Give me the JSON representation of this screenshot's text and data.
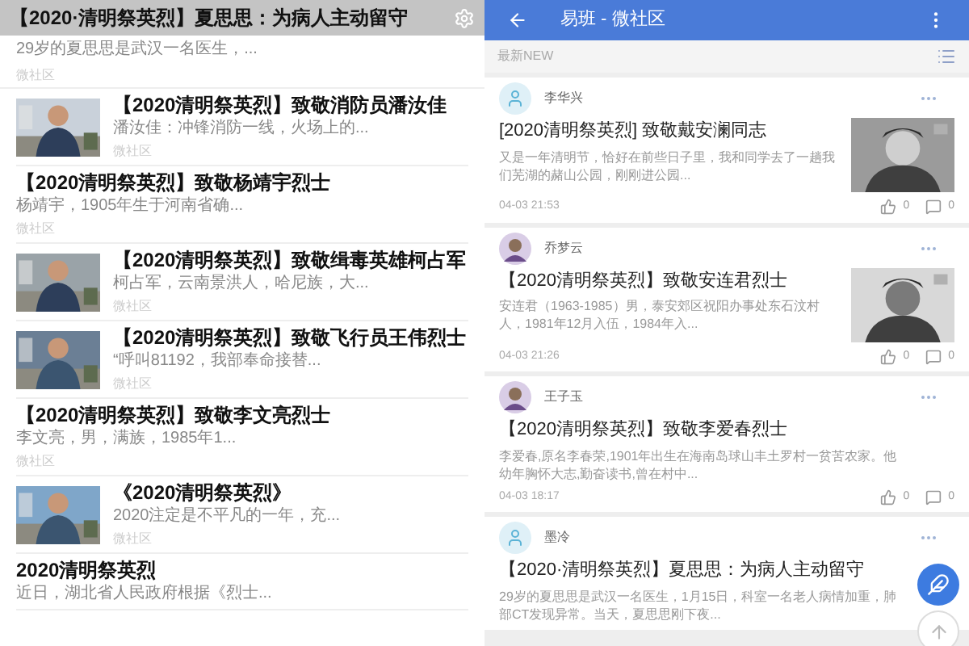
{
  "left_panel": {
    "items": [
      {
        "kind": "header",
        "title": "【2020·清明祭英烈】夏思思：为病人主动留守",
        "description": "29岁的夏思思是武汉一名医生，...",
        "source": "微社区"
      },
      {
        "kind": "picture",
        "title": "【2020清明祭英烈】致敬消防员潘汝佳",
        "description": "潘汝佳：冲锋消防一线，火场上的...",
        "source": "微社区"
      },
      {
        "kind": "text",
        "title": "【2020清明祭英烈】致敬杨靖宇烈士",
        "description": "杨靖宇，1905年生于河南省确...",
        "source": "微社区"
      },
      {
        "kind": "picture",
        "title": "【2020清明祭英烈】致敬缉毒英雄柯占军",
        "description": "柯占军，云南景洪人，哈尼族，大...",
        "source": "微社区"
      },
      {
        "kind": "picture",
        "title": "【2020清明祭英烈】致敬飞行员王伟烈士",
        "description": "“呼叫81192，我部奉命接替...",
        "source": "微社区"
      },
      {
        "kind": "text",
        "title": "【2020清明祭英烈】致敬李文亮烈士",
        "description": "李文亮，男，满族，1985年1...",
        "source": "微社区"
      },
      {
        "kind": "picture",
        "title": "《2020清明祭英烈》",
        "description": "2020注定是不平凡的一年，充...",
        "source": "微社区"
      },
      {
        "kind": "text",
        "title": "2020清明祭英烈",
        "description": "近日，湖北省人民政府根据《烈士..."
      }
    ]
  },
  "right_panel": {
    "app_bar": {
      "title": "易班 - 微社区"
    },
    "filter_bar": {
      "label": "最新NEW"
    },
    "posts": [
      {
        "kind": "picture",
        "avatar": {
          "kind": "default"
        },
        "author": "李华兴",
        "title": "[2020清明祭英烈] 致敬戴安澜同志",
        "description": "又是一年清明节，恰好在前些日子里，我和同学去了一趟我们芜湖的赭山公园，刚刚进公园...",
        "time": "04-03 21:53",
        "likes": "0",
        "comments": "0"
      },
      {
        "kind": "picture",
        "author": "乔梦云",
        "title": "【2020清明祭英烈】致敬安连君烈士",
        "description": "安连君（1963-1985）男，泰安郊区祝阳办事处东石汶村人，1981年12月入伍，1984年入...",
        "time": "04-03 21:26",
        "likes": "0",
        "comments": "0"
      },
      {
        "kind": "text",
        "author": "王子玉",
        "title": "【2020清明祭英烈】致敬李爱春烈士",
        "description": "李爱春,原名李春荣,1901年出生在海南岛球山丰土罗村一贫苦农家。他幼年胸怀大志,勤奋读书,曾在村中...",
        "time": "04-03 18:17",
        "likes": "0",
        "comments": "0"
      },
      {
        "kind": "text",
        "avatar": {
          "kind": "default"
        },
        "author": "墨冷",
        "title": "【2020·清明祭英烈】夏思思：为病人主动留守",
        "description": "29岁的夏思思是武汉一名医生，1月15日，科室一名老人病情加重，肺部CT发现异常。当天，夏思思刚下夜..."
      }
    ]
  }
}
